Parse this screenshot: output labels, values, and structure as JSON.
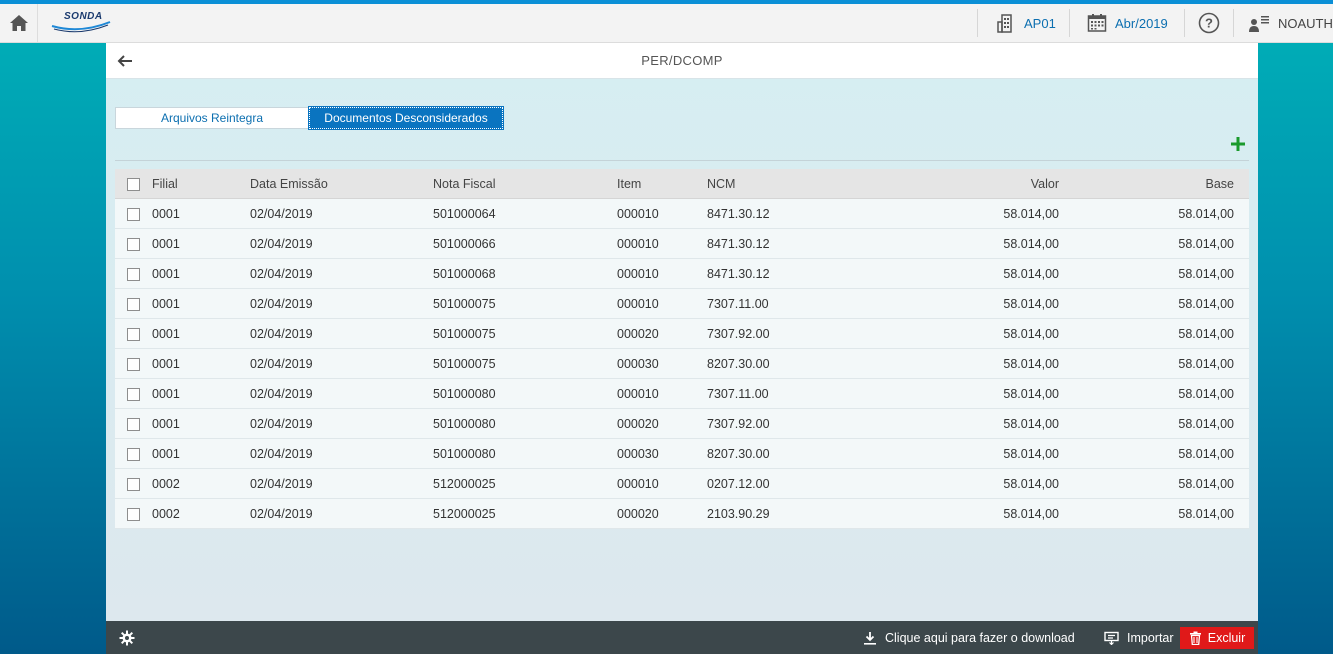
{
  "topbar": {
    "logo_text": "SONDA",
    "company": "AP01",
    "period": "Abr/2019",
    "user": "NOAUTH"
  },
  "page": {
    "title": "PER/DCOMP"
  },
  "tabs": [
    {
      "label": "Arquivos Reintegra",
      "active": false
    },
    {
      "label": "Documentos Desconsiderados",
      "active": true
    }
  ],
  "table": {
    "columns": {
      "filial": "Filial",
      "data": "Data Emissão",
      "nota": "Nota Fiscal",
      "item": "Item",
      "ncm": "NCM",
      "valor": "Valor",
      "base": "Base"
    },
    "rows": [
      {
        "filial": "0001",
        "data": "02/04/2019",
        "nota": "501000064",
        "item": "000010",
        "ncm": "8471.30.12",
        "valor": "58.014,00",
        "base": "58.014,00"
      },
      {
        "filial": "0001",
        "data": "02/04/2019",
        "nota": "501000066",
        "item": "000010",
        "ncm": "8471.30.12",
        "valor": "58.014,00",
        "base": "58.014,00"
      },
      {
        "filial": "0001",
        "data": "02/04/2019",
        "nota": "501000068",
        "item": "000010",
        "ncm": "8471.30.12",
        "valor": "58.014,00",
        "base": "58.014,00"
      },
      {
        "filial": "0001",
        "data": "02/04/2019",
        "nota": "501000075",
        "item": "000010",
        "ncm": "7307.11.00",
        "valor": "58.014,00",
        "base": "58.014,00"
      },
      {
        "filial": "0001",
        "data": "02/04/2019",
        "nota": "501000075",
        "item": "000020",
        "ncm": "7307.92.00",
        "valor": "58.014,00",
        "base": "58.014,00"
      },
      {
        "filial": "0001",
        "data": "02/04/2019",
        "nota": "501000075",
        "item": "000030",
        "ncm": "8207.30.00",
        "valor": "58.014,00",
        "base": "58.014,00"
      },
      {
        "filial": "0001",
        "data": "02/04/2019",
        "nota": "501000080",
        "item": "000010",
        "ncm": "7307.11.00",
        "valor": "58.014,00",
        "base": "58.014,00"
      },
      {
        "filial": "0001",
        "data": "02/04/2019",
        "nota": "501000080",
        "item": "000020",
        "ncm": "7307.92.00",
        "valor": "58.014,00",
        "base": "58.014,00"
      },
      {
        "filial": "0001",
        "data": "02/04/2019",
        "nota": "501000080",
        "item": "000030",
        "ncm": "8207.30.00",
        "valor": "58.014,00",
        "base": "58.014,00"
      },
      {
        "filial": "0002",
        "data": "02/04/2019",
        "nota": "512000025",
        "item": "000010",
        "ncm": "0207.12.00",
        "valor": "58.014,00",
        "base": "58.014,00"
      },
      {
        "filial": "0002",
        "data": "02/04/2019",
        "nota": "512000025",
        "item": "000020",
        "ncm": "2103.90.29",
        "valor": "58.014,00",
        "base": "58.014,00"
      }
    ]
  },
  "footer": {
    "download_label": "Clique aqui para fazer o download",
    "import_label": "Importar",
    "delete_label": "Excluir"
  },
  "colors": {
    "accent": "#0a74c0",
    "delete": "#e01919",
    "add": "#1a9a2c",
    "footer_bg": "#3c474b"
  },
  "icons": [
    "home-icon",
    "building-icon",
    "calendar-icon",
    "help-icon",
    "user-menu-icon",
    "back-arrow-icon",
    "plus-icon",
    "gear-icon",
    "download-icon",
    "import-icon",
    "trash-icon"
  ]
}
